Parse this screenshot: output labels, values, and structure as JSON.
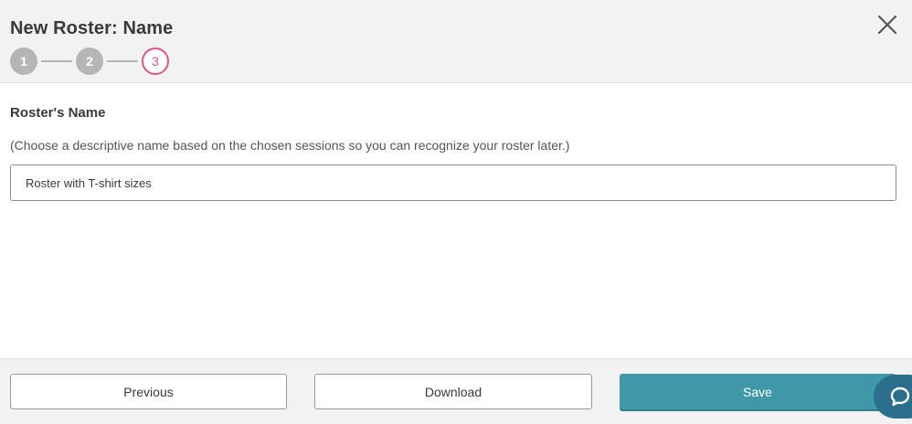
{
  "header": {
    "title": "New Roster: Name",
    "close_icon": "close-icon",
    "steps": [
      {
        "label": "1",
        "state": "done"
      },
      {
        "label": "2",
        "state": "done"
      },
      {
        "label": "3",
        "state": "active"
      }
    ]
  },
  "form": {
    "label": "Roster's Name",
    "help": "(Choose a descriptive name based on the chosen sessions so you can recognize your roster later.)",
    "name_value": "Roster with T-shirt sizes"
  },
  "footer": {
    "previous_label": "Previous",
    "download_label": "Download",
    "save_label": "Save"
  },
  "chat": {
    "icon": "chat-icon"
  },
  "colors": {
    "accent": "#e0548a",
    "primary_button": "#3e98a8",
    "step_done": "#b5b5b5",
    "chat_bubble": "#2c6f8d"
  }
}
